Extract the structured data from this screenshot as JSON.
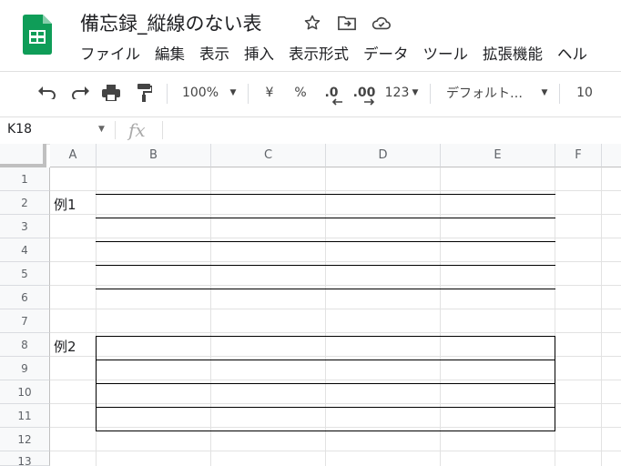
{
  "header": {
    "doc_title": "備忘録_縦線のない表",
    "menu": [
      "ファイル",
      "編集",
      "表示",
      "挿入",
      "表示形式",
      "データ",
      "ツール",
      "拡張機能",
      "ヘル"
    ]
  },
  "toolbar": {
    "zoom": "100%",
    "currency": "¥",
    "percent": "%",
    "dec_decrease": ".0",
    "dec_increase": ".00",
    "number_format": "123",
    "font": "デフォルト…",
    "font_size": "10"
  },
  "formula_bar": {
    "name_box": "K18",
    "fx": "fx"
  },
  "sheet": {
    "columns": [
      "A",
      "B",
      "C",
      "D",
      "E",
      "F"
    ],
    "rows": [
      "1",
      "2",
      "3",
      "4",
      "5",
      "6",
      "7",
      "8",
      "9",
      "10",
      "11",
      "12",
      "13"
    ],
    "cells": {
      "A2": "例1",
      "A8": "例2"
    }
  },
  "colors": {
    "logo_green": "#0F9D58",
    "border_black": "#000000"
  }
}
